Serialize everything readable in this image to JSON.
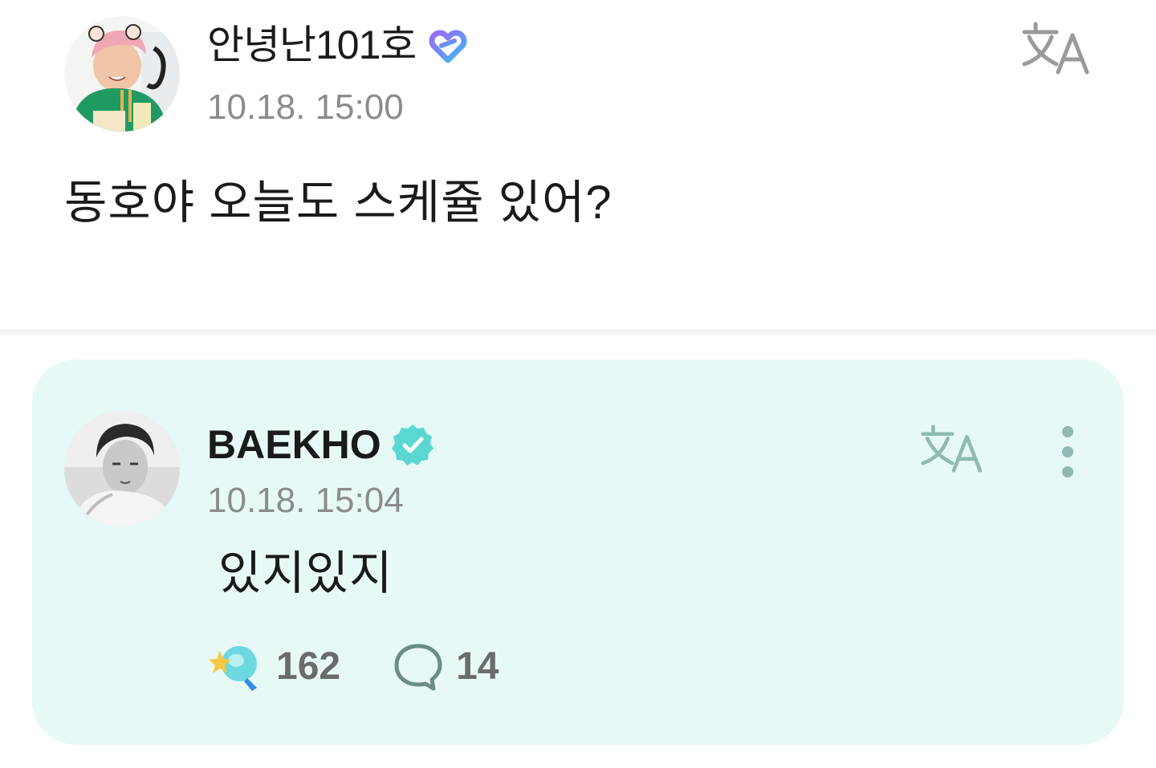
{
  "post": {
    "author": "안녕난101호",
    "time": "10.18. 15:00",
    "body": "동호야 오늘도 스케쥴 있어?",
    "badge_icon": "heart-membership-icon",
    "translate_icon": "translate-icon"
  },
  "reply": {
    "author": "BAEKHO",
    "time": "10.18. 15:04",
    "body": "있지있지",
    "verified_icon": "verified-check-icon",
    "translate_icon": "translate-icon",
    "more_icon": "more-vertical-icon",
    "likes": "162",
    "comments": "14",
    "like_icon": "star-lightstick-icon",
    "comment_icon": "speech-bubble-icon"
  },
  "colors": {
    "card_background": "#e6f9f6",
    "accent_teal": "#5ad7d1",
    "muted_text": "#8c8c8c",
    "divider": "#f3f4f6"
  }
}
